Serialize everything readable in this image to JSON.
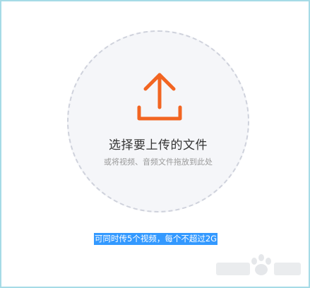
{
  "upload": {
    "primary_text": "选择要上传的文件",
    "secondary_text": "或将视频、音频文件拖放到此处",
    "icon": "upload-arrow-icon",
    "accent_color": "#f26522"
  },
  "limit_note": "可同时传5个视频，每个不超过2G",
  "colors": {
    "frame_border": "#a6dbe6",
    "dropzone_bg": "#f5f6f9",
    "dropzone_border": "#cfd2dc",
    "highlight": "#3399ff"
  }
}
